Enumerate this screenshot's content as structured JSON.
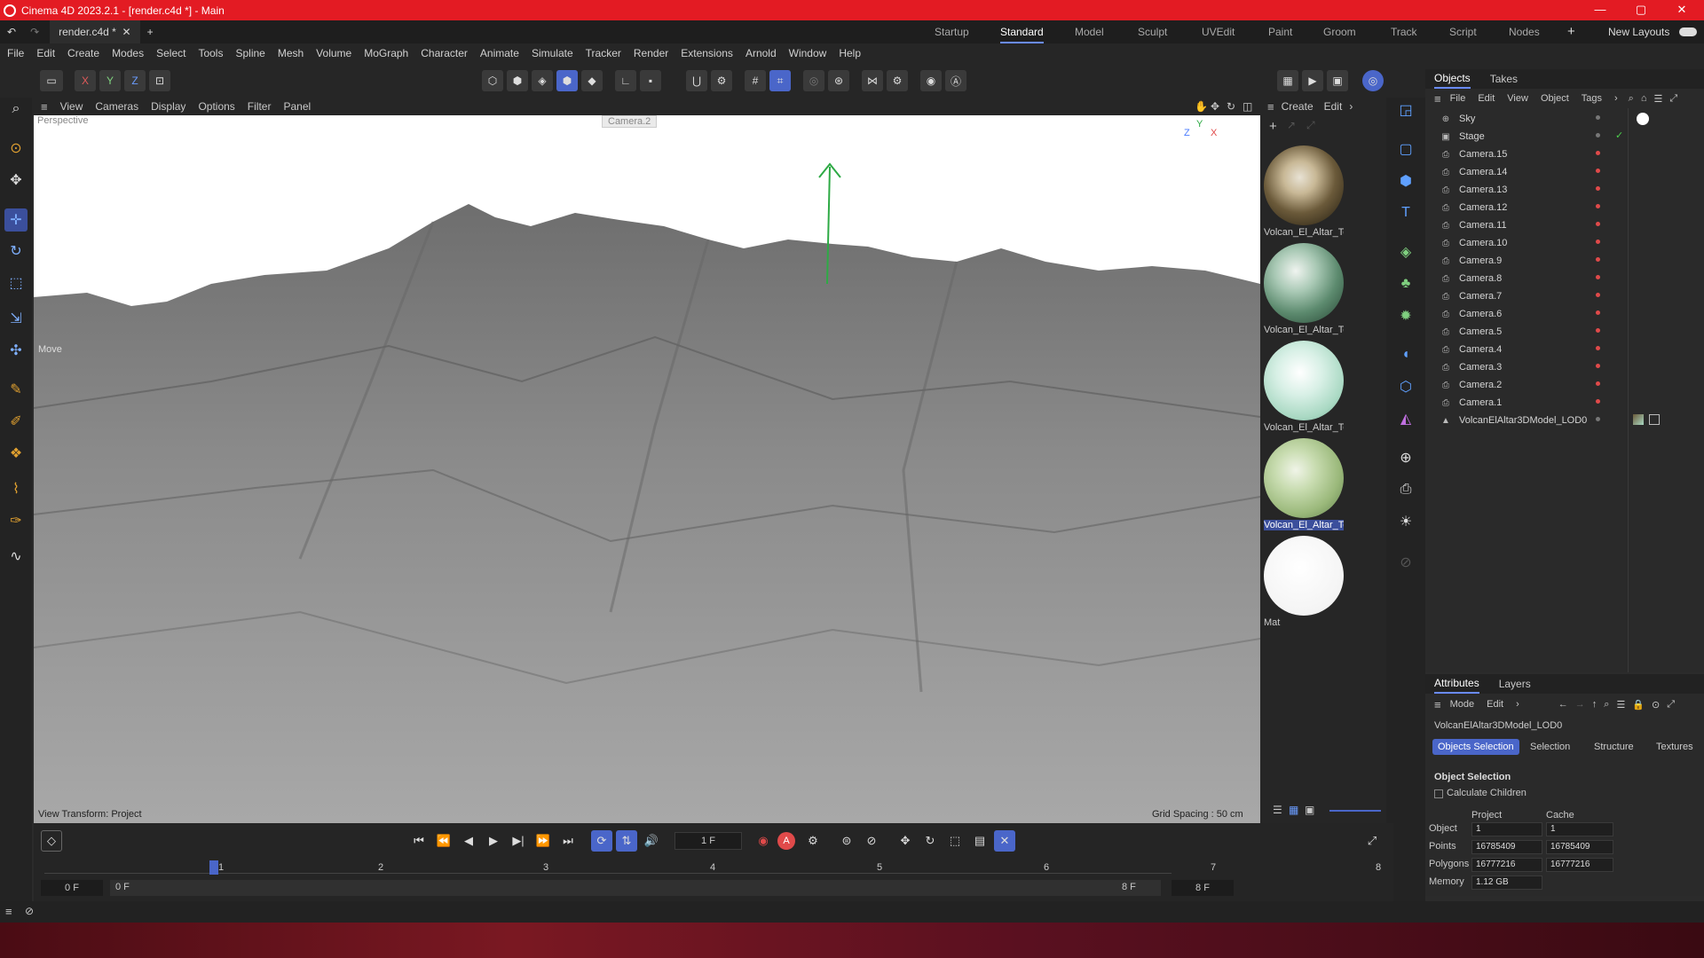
{
  "window": {
    "title": "Cinema 4D 2023.2.1 - [render.c4d *] - Main",
    "min": "—",
    "max": "▢",
    "close": "✕"
  },
  "tabs": {
    "doc": "render.c4d *",
    "close": "✕",
    "add": "+"
  },
  "layouts": {
    "items": [
      "Startup",
      "Standard",
      "Model",
      "Sculpt",
      "UVEdit",
      "Paint",
      "Groom",
      "Track",
      "Script",
      "Nodes"
    ],
    "active": "Standard",
    "new_layouts": "New Layouts",
    "add": "+"
  },
  "menu": [
    "File",
    "Edit",
    "Create",
    "Modes",
    "Select",
    "Tools",
    "Spline",
    "Mesh",
    "Volume",
    "MoGraph",
    "Character",
    "Animate",
    "Simulate",
    "Tracker",
    "Render",
    "Extensions",
    "Arnold",
    "Window",
    "Help"
  ],
  "toolbar": {
    "x": "X",
    "y": "Y",
    "z": "Z"
  },
  "viewport": {
    "menu": [
      "View",
      "Cameras",
      "Display",
      "Options",
      "Filter",
      "Panel"
    ],
    "perspective": "Perspective",
    "camera": "Camera.2",
    "tool": "Move",
    "view_transform": "View Transform: Project",
    "grid_spacing": "Grid Spacing : 50 cm",
    "axis": {
      "z": "Z",
      "y": "Y",
      "x": "X"
    }
  },
  "materials": {
    "menu": [
      "Create",
      "Edit"
    ],
    "items": [
      {
        "name": "Volcan_El_Altar_Te",
        "color": "#6b5a3a"
      },
      {
        "name": "Volcan_El_Altar_Te",
        "color": "#5c8a6e"
      },
      {
        "name": "Volcan_El_Altar_Te",
        "color": "#a8d8c2"
      },
      {
        "name": "Volcan_El_Altar_Te",
        "color": "#9ab87a"
      },
      {
        "name": "Mat",
        "color": "#ffffff"
      }
    ]
  },
  "objects": {
    "tabs": [
      "Objects",
      "Takes"
    ],
    "menu": [
      "File",
      "Edit",
      "View",
      "Object",
      "Tags"
    ],
    "rows": [
      "Sky",
      "Stage",
      "Camera.15",
      "Camera.14",
      "Camera.13",
      "Camera.12",
      "Camera.11",
      "Camera.10",
      "Camera.9",
      "Camera.8",
      "Camera.7",
      "Camera.6",
      "Camera.5",
      "Camera.4",
      "Camera.3",
      "Camera.2",
      "Camera.1",
      "VolcanElAltar3DModel_LOD0"
    ]
  },
  "attributes": {
    "tabs": [
      "Attributes",
      "Layers"
    ],
    "menu": [
      "Mode",
      "Edit"
    ],
    "object_name": "VolcanElAltar3DModel_LOD0",
    "subtabs": [
      "Objects Selection",
      "Selection",
      "Structure",
      "Textures"
    ],
    "section": "Object Selection",
    "calc_children": "Calculate Children",
    "col_project": "Project",
    "col_cache": "Cache",
    "rows": [
      {
        "label": "Object",
        "project": "1",
        "cache": "1"
      },
      {
        "label": "Points",
        "project": "16785409",
        "cache": "16785409"
      },
      {
        "label": "Polygons",
        "project": "16777216",
        "cache": "16777216"
      },
      {
        "label": "Memory",
        "project": "1.12 GB",
        "cache": ""
      }
    ]
  },
  "timeline": {
    "frame": "1 F",
    "ticks": [
      "1",
      "2",
      "3",
      "4",
      "5",
      "6",
      "7",
      "8"
    ],
    "start": "0 F",
    "start2": "0 F",
    "end": "8 F",
    "end2": "8 F",
    "auto_key": "A"
  }
}
